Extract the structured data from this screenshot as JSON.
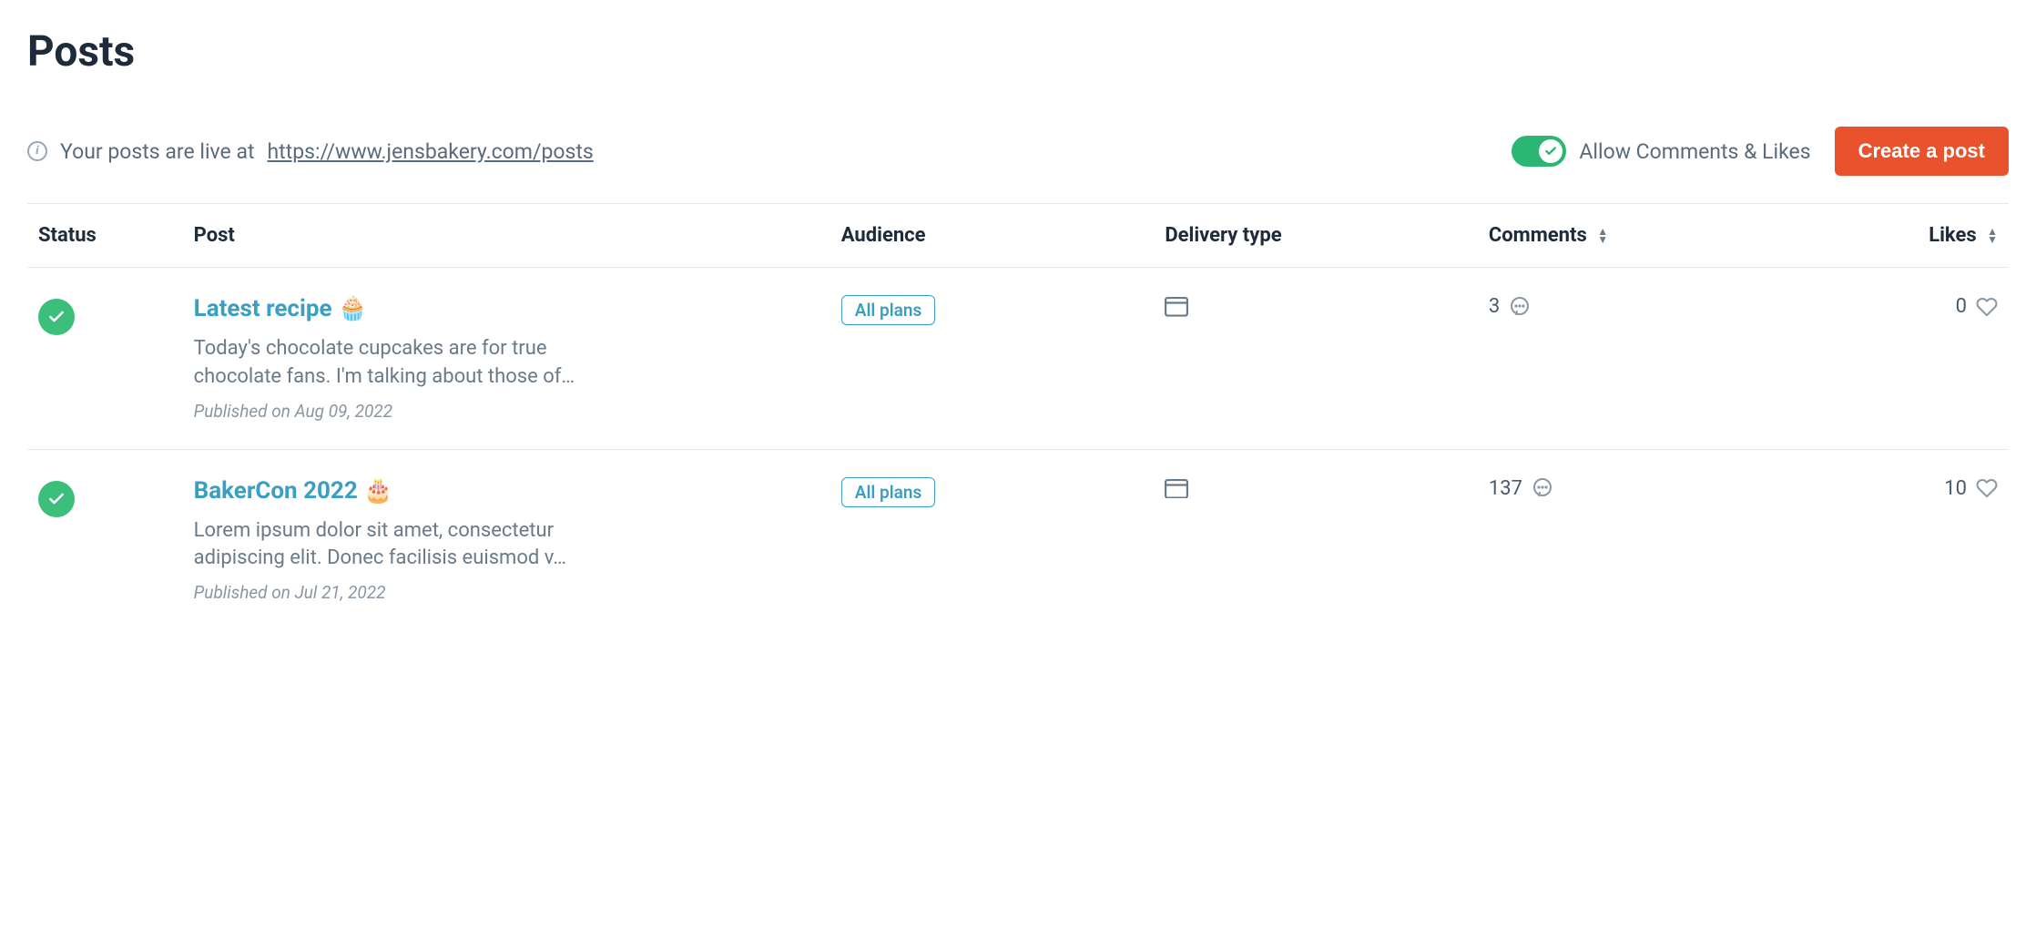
{
  "page": {
    "title": "Posts",
    "live_prefix": "Your posts are live at",
    "live_url": "https://www.jensbakery.com/posts",
    "toggle_label": "Allow Comments & Likes",
    "toggle_on": true,
    "create_button": "Create a post"
  },
  "columns": {
    "status": "Status",
    "post": "Post",
    "audience": "Audience",
    "delivery": "Delivery type",
    "comments": "Comments",
    "likes": "Likes"
  },
  "rows": [
    {
      "status": "published",
      "title": "Latest recipe 🧁",
      "excerpt": "Today's chocolate cupcakes are for true chocolate fans. I'm talking about those of…",
      "published_label": "Published on Aug 09, 2022",
      "audience": "All plans",
      "delivery": "web",
      "comments": "3",
      "likes": "0"
    },
    {
      "status": "published",
      "title": "BakerCon 2022 🎂",
      "excerpt": "Lorem ipsum dolor sit amet, consectetur adipiscing elit. Donec facilisis euismod v…",
      "published_label": "Published on Jul 21, 2022",
      "audience": "All plans",
      "delivery": "web",
      "comments": "137",
      "likes": "10"
    }
  ]
}
